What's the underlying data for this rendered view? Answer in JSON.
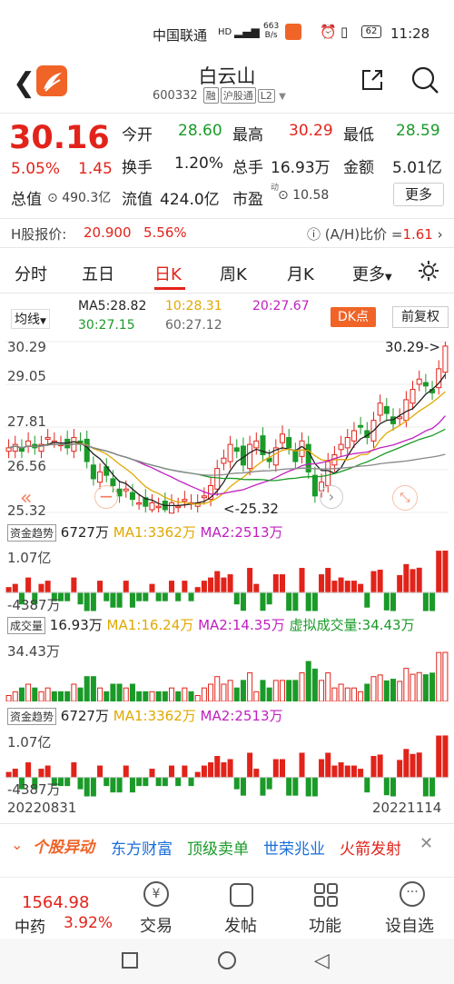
{
  "status": {
    "carrier": "中国联通",
    "net_speed_top": "663",
    "net_speed_bottom": "B/s",
    "battery": "62",
    "time": "11:28"
  },
  "header": {
    "title": "白云山",
    "code": "600332",
    "tags": [
      "融",
      "沪股通",
      "L2"
    ]
  },
  "quote": {
    "price": "30.16",
    "change_pct": "5.05%",
    "change_val": "1.45",
    "open_label": "今开",
    "open": "28.60",
    "high_label": "最高",
    "high": "30.29",
    "low_label": "最低",
    "low": "28.59",
    "turnover_label": "换手",
    "turnover": "1.20%",
    "volume_label": "总手",
    "volume": "16.93万",
    "amount_label": "金额",
    "amount": "5.01亿",
    "mcap_label": "总值",
    "mcap": "490.3亿",
    "float_label": "流值",
    "float": "424.0亿",
    "pe_label": "市盈",
    "pe_sup": "动",
    "pe": "10.58",
    "more": "更多"
  },
  "hshare": {
    "label": "H股报价:",
    "price": "20.900",
    "pct": "5.56%",
    "ah_label": "(A/H)比价 =",
    "ah": "1.61"
  },
  "tabs": [
    "分时",
    "五日",
    "日K",
    "周K",
    "月K",
    "更多"
  ],
  "active_tab": "日K",
  "ma": {
    "type": "均线",
    "ma5": "MA5:28.82",
    "ma10": "10:28.31",
    "ma20": "20:27.67",
    "ma30": "30:27.15",
    "ma60": "60:27.12",
    "dk": "DK点",
    "fq": "前复权"
  },
  "yaxis": [
    "30.29",
    "29.05",
    "27.81",
    "26.56",
    "25.32"
  ],
  "annot_high": "30.29->",
  "annot_low": "<-25.32",
  "ind1": {
    "name": "资金趋势",
    "val": "6727万",
    "ma1": "MA1:3362万",
    "ma2": "MA2:2513万",
    "top": "1.07亿",
    "bottom": "-4387万"
  },
  "ind2": {
    "name": "成交量",
    "val": "16.93万",
    "ma1": "MA1:16.24万",
    "ma2": "MA2:14.35万",
    "virt": "虚拟成交量:34.43万",
    "top": "34.43万"
  },
  "ind3": {
    "name": "资金趋势",
    "val": "6727万",
    "ma1": "MA1:3362万",
    "ma2": "MA2:2513万",
    "top": "1.07亿",
    "bottom": "-4387万"
  },
  "dates": {
    "start": "20220831",
    "end": "20221114"
  },
  "news": {
    "brand": "个股异动",
    "items": [
      "东方财富",
      "顶级卖单",
      "世荣兆业",
      "火箭发射"
    ]
  },
  "bottom": {
    "index_val": "1564.98",
    "index_name": "中药",
    "index_pct": "3.92%",
    "items": [
      "交易",
      "发帖",
      "功能",
      "设自选"
    ]
  },
  "chart_data": {
    "type": "candlestick",
    "title": "",
    "ylim": [
      25.32,
      30.29
    ],
    "closes": [
      27.2,
      27.3,
      27.1,
      27.4,
      27.2,
      27.3,
      27.5,
      27.4,
      27.3,
      27.2,
      27.5,
      27.3,
      26.8,
      26.3,
      26.5,
      26.4,
      26.1,
      25.8,
      26.0,
      25.7,
      25.6,
      25.5,
      25.6,
      25.5,
      25.4,
      25.6,
      25.5,
      25.7,
      25.6,
      25.6,
      25.8,
      26.1,
      26.6,
      26.9,
      27.3,
      27.1,
      26.7,
      27.3,
      27.4,
      27.0,
      26.8,
      27.2,
      27.6,
      27.2,
      26.8,
      27.4,
      26.5,
      25.8,
      26.2,
      26.8,
      27.0,
      27.3,
      27.5,
      27.7,
      27.8,
      27.5,
      28.0,
      28.5,
      28.2,
      27.9,
      28.1,
      28.6,
      28.9,
      29.2,
      29.0,
      28.8,
      29.5,
      30.16
    ]
  }
}
